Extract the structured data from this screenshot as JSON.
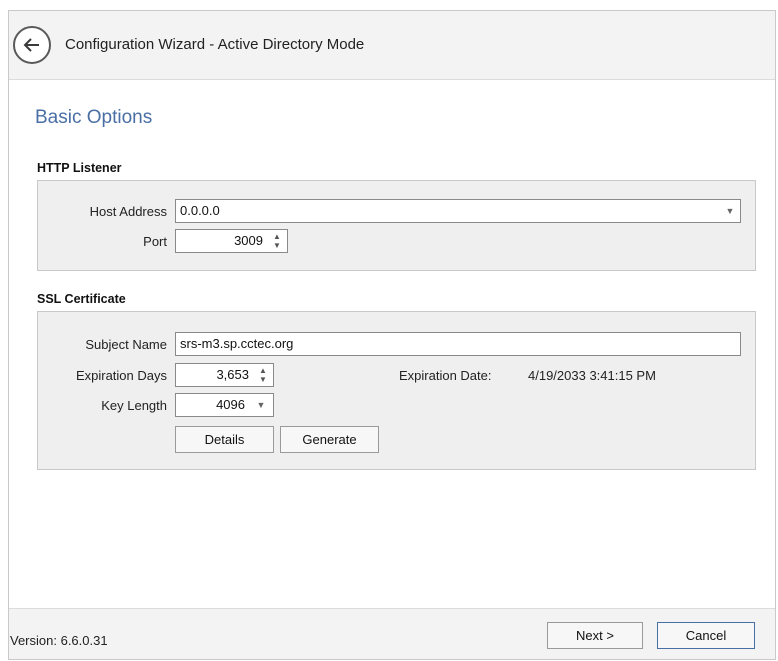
{
  "window": {
    "title": "Configuration Wizard - Active Directory Mode"
  },
  "icons": {
    "back": "arrow-left-circle-icon",
    "dropdown": "chevron-down-icon",
    "spinner": "spin-up-down-icon"
  },
  "page": {
    "heading": "Basic Options"
  },
  "http_listener": {
    "label": "HTTP Listener",
    "host_address_label": "Host Address",
    "host_address_value": "0.0.0.0",
    "port_label": "Port",
    "port_value": "3009"
  },
  "ssl_certificate": {
    "label": "SSL Certificate",
    "subject_name_label": "Subject Name",
    "subject_name_value": "srs-m3.sp.cctec.org",
    "expiration_days_label": "Expiration Days",
    "expiration_days_value": "3,653",
    "expiration_date_label": "Expiration Date:",
    "expiration_date_value": "4/19/2033 3:41:15 PM",
    "key_length_label": "Key Length",
    "key_length_value": "4096",
    "details_button": "Details",
    "generate_button": "Generate"
  },
  "footer": {
    "version": "Version: 6.6.0.31",
    "next_button": "Next >",
    "cancel_button": "Cancel"
  },
  "colors": {
    "heading": "#4a6fa5",
    "group_background": "#efefef",
    "titlebar_background": "#f3f3f3"
  }
}
